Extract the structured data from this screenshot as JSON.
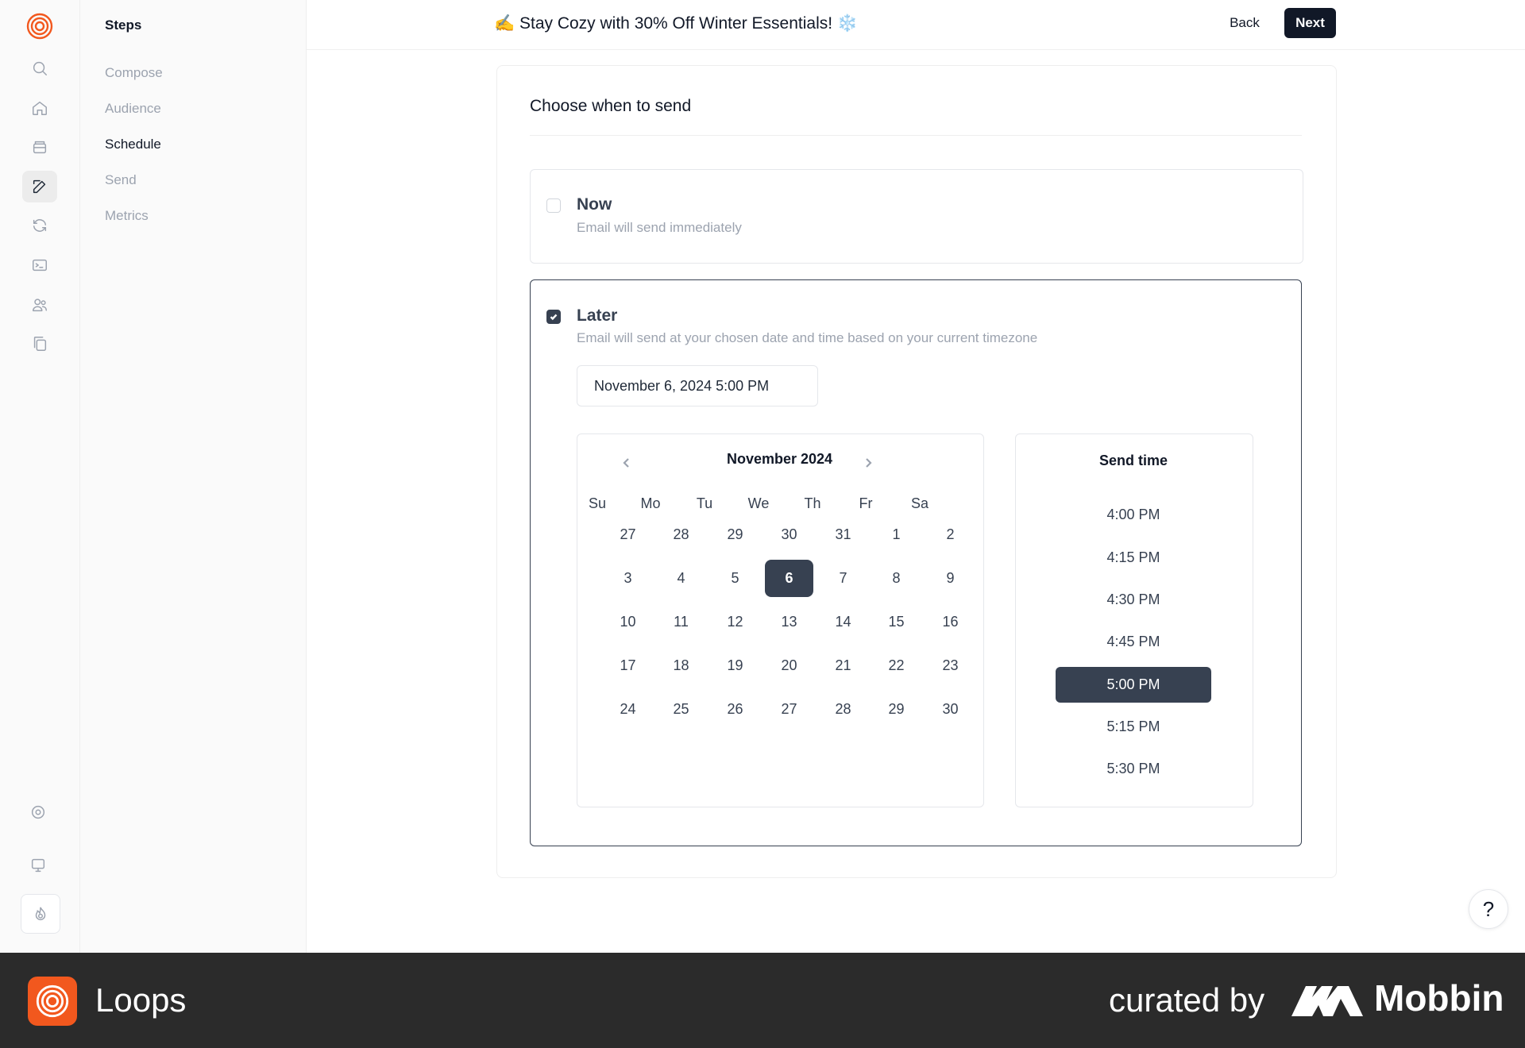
{
  "header": {
    "title": "✍️ Stay Cozy with 30% Off Winter Essentials! ❄️",
    "back_label": "Back",
    "next_label": "Next"
  },
  "rail": {
    "icons": [
      "search-icon",
      "home-icon",
      "inbox-icon",
      "edit-icon",
      "refresh-icon",
      "terminal-icon",
      "users-icon",
      "copy-icon",
      "settings-icon",
      "monitor-icon",
      "flame-icon"
    ],
    "active": "edit-icon"
  },
  "steps": {
    "title": "Steps",
    "items": [
      {
        "label": "Compose"
      },
      {
        "label": "Audience"
      },
      {
        "label": "Schedule"
      },
      {
        "label": "Send"
      },
      {
        "label": "Metrics"
      }
    ],
    "active": "Schedule"
  },
  "schedule": {
    "heading": "Choose when to send",
    "now": {
      "title": "Now",
      "desc": "Email will send immediately",
      "checked": false
    },
    "later": {
      "title": "Later",
      "desc": "Email will send at your chosen date and time based on your current timezone",
      "checked": true
    },
    "date_value": "November 6, 2024 5:00 PM"
  },
  "calendar": {
    "month": "November 2024",
    "weekdays": [
      "Su",
      "Mo",
      "Tu",
      "We",
      "Th",
      "Fr",
      "Sa"
    ],
    "weeks": [
      [
        "27",
        "28",
        "29",
        "30",
        "31",
        "1",
        "2"
      ],
      [
        "3",
        "4",
        "5",
        "6",
        "7",
        "8",
        "9"
      ],
      [
        "10",
        "11",
        "12",
        "13",
        "14",
        "15",
        "16"
      ],
      [
        "17",
        "18",
        "19",
        "20",
        "21",
        "22",
        "23"
      ],
      [
        "24",
        "25",
        "26",
        "27",
        "28",
        "29",
        "30"
      ]
    ],
    "selected": "6"
  },
  "time_picker": {
    "title": "Send time",
    "times": [
      "4:00 PM",
      "4:15 PM",
      "4:30 PM",
      "4:45 PM",
      "5:00 PM",
      "5:15 PM",
      "5:30 PM"
    ],
    "selected": "5:00 PM"
  },
  "help": {
    "label": "?"
  },
  "footer": {
    "brand": "Loops",
    "curated": "curated by",
    "mobbin": "Mobbin"
  },
  "colors": {
    "accent": "#f2581e",
    "dark": "#374151",
    "button": "#111827"
  }
}
